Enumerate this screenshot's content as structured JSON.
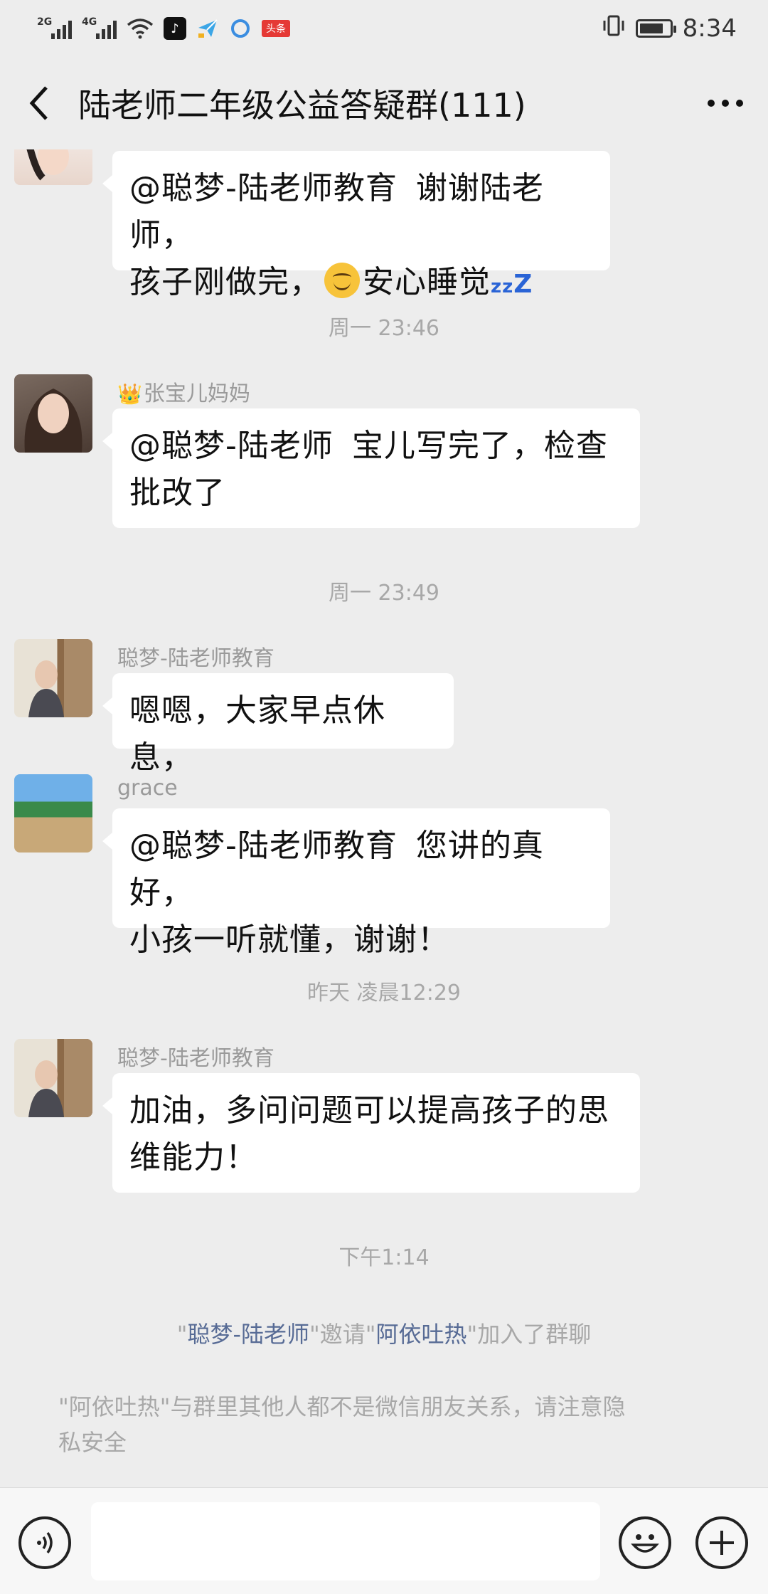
{
  "status_bar": {
    "sim1": "2G",
    "sim2": "4G",
    "app_icons": [
      "tiktok-icon",
      "paper-plane-icon",
      "browser-icon",
      "toutiao-icon"
    ],
    "toutiao_label": "头条",
    "time": "8:34",
    "battery_level": 0.8
  },
  "header": {
    "title": "陆老师二年级公益答疑群(111)",
    "back_icon": "chevron-left-icon",
    "more_icon": "more-dots-icon"
  },
  "messages": [
    {
      "id": "m1",
      "sender": "",
      "text_line1": "@聪梦-陆老师教育",
      "text_line1b": "谢谢陆老师，",
      "text_line2a": "孩子刚做完，",
      "text_line2b": "安心睡觉",
      "zz": "zzZ"
    },
    {
      "id": "t1",
      "time": "周一 23:46"
    },
    {
      "id": "m2",
      "sender": "张宝儿妈妈",
      "text_line1a": "@聪梦-陆老师",
      "text_line1b": "宝儿写完了，检查",
      "text_line2": "批改了"
    },
    {
      "id": "t2",
      "time": "周一 23:49"
    },
    {
      "id": "m3",
      "sender": "聪梦-陆老师教育",
      "text": "嗯嗯，大家早点休息，"
    },
    {
      "id": "m4",
      "sender": "grace",
      "text_line1a": "@聪梦-陆老师教育",
      "text_line1b": "您讲的真好，",
      "text_line2": "小孩一听就懂，谢谢！"
    },
    {
      "id": "t3",
      "time": "昨天 凌晨12:29"
    },
    {
      "id": "m5",
      "sender": "聪梦-陆老师教育",
      "text_line1": "加油，多问问题可以提高孩子的思",
      "text_line2": "维能力！"
    },
    {
      "id": "t4",
      "time": "下午1:14"
    }
  ],
  "system": {
    "invite_q1": "\"",
    "inviter": "聪梦-陆老师",
    "invite_mid": "\"邀请\"",
    "invitee": "阿依吐热",
    "invite_end": "\"加入了群聊",
    "privacy_line1": "\"阿依吐热\"与群里其他人都不是微信朋友关系，请注意隐",
    "privacy_line2": "私安全"
  },
  "bottom_bar": {
    "voice_icon": "voice-icon",
    "emoji_icon": "emoji-icon",
    "plus_icon": "plus-icon"
  }
}
